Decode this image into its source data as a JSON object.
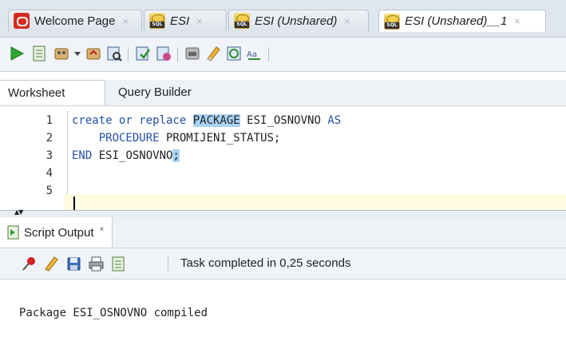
{
  "tabs": [
    {
      "label": "Welcome Page",
      "close": "×",
      "icon": "oracle-icon",
      "italic": false,
      "active": false
    },
    {
      "label": "ESI",
      "close": "×",
      "icon": "sql-worksheet-icon",
      "italic": true,
      "active": false
    },
    {
      "label": "ESI (Unshared)",
      "close": "×",
      "icon": "sql-worksheet-icon",
      "italic": true,
      "active": false
    },
    {
      "label": "ESI (Unshared)__1",
      "close": "×",
      "icon": "sql-worksheet-icon",
      "italic": true,
      "active": true
    }
  ],
  "toolbar": {
    "icons": [
      "run-statement-icon",
      "run-script-icon",
      "commit-icon",
      "dropdown-icon",
      "rollback-icon",
      "explain-plan-icon",
      "autotrace-icon",
      "sql-tuning-icon",
      "unshared-sql-icon",
      "clear-icon",
      "sql-history-icon",
      "to-upper-lower-icon"
    ]
  },
  "worksheet": {
    "tabs": [
      "Worksheet",
      "Query Builder"
    ]
  },
  "editor": {
    "line_numbers": [
      "1",
      "2",
      "3",
      "4",
      "5"
    ],
    "lines": [
      {
        "k1": "create or replace ",
        "hl": "PACKAGE",
        "rest": " ESI_OSNOVNO ",
        "k2": "AS"
      },
      {
        "indent": "    ",
        "k1": "PROCEDURE",
        "rest": " PROMIJENI_STATUS;"
      },
      {
        "k1": "END",
        "rest": " ESI_OSNOVNO",
        "hl": ";"
      }
    ]
  },
  "output": {
    "tab_label": "Script Output",
    "tab_close": "×",
    "status": "Task completed in 0,25 seconds",
    "text": "Package ESI_OSNOVNO compiled",
    "toolbar_icons": [
      "pin-icon",
      "clear-output-icon",
      "save-icon",
      "print-icon",
      "open-file-icon"
    ]
  },
  "colors": {
    "keyword": "#2350a8",
    "selection_highlight": "#aad3f5",
    "current_line": "#fffbe1"
  }
}
